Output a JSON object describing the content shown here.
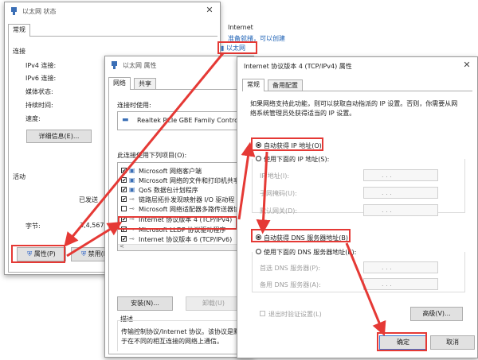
{
  "status_window": {
    "title": "以太网 状态",
    "tab": "常规",
    "section_connection": "连接",
    "ipv4_label": "IPv4 连接:",
    "ipv6_label": "IPv6 连接:",
    "media_label": "媒体状态:",
    "duration_label": "持续时间:",
    "speed_label": "速度:",
    "details_button": "详细信息(E)...",
    "section_activity": "活动",
    "sent_label": "已发送",
    "bytes_label": "字节:",
    "bytes_value": "3,4,567,3",
    "properties_button": "属性(P)",
    "disable_button": "禁用(D"
  },
  "network_list": {
    "heading": "Internet",
    "link": "准备就绪，可以创建",
    "ethernet": "以太网"
  },
  "props_window": {
    "title": "以太网 属性",
    "tabs": [
      "网络",
      "共享"
    ],
    "connect_using": "连接时使用:",
    "adapter": "Realtek PCIe GBE Family Controlle",
    "items_label": "此连接使用下列项目(O):",
    "items": [
      {
        "checked": "✔",
        "label": "Microsoft 网络客户端"
      },
      {
        "checked": "✔",
        "label": "Microsoft 网络的文件和打印机共享"
      },
      {
        "checked": "✔",
        "label": "QoS 数据包计划程序"
      },
      {
        "checked": "✔",
        "label": "链路层拓扑发现映射器 I/O 驱动程"
      },
      {
        "checked": "",
        "label": "Microsoft 网络适配器多路传送器协"
      },
      {
        "checked": "✔",
        "label": "Internet 协议版本 4 (TCP/IPv4)"
      },
      {
        "checked": "✔",
        "label": "Microsoft LLDP 协议驱动程序"
      },
      {
        "checked": "✔",
        "label": "Internet 协议版本 6 (TCP/IPv6)"
      }
    ],
    "install_button": "安装(N)...",
    "uninstall_button": "卸载(U)",
    "description_heading": "描述",
    "description_line1": "传输控制协议/Internet 协议。该协议是默",
    "description_line2": "于在不同的相互连接的网络上通信。"
  },
  "ipv4_window": {
    "title": "Internet 协议版本 4 (TCP/IPv4) 属性",
    "tabs": [
      "常规",
      "备用配置"
    ],
    "intro_line1": "如果网络支持此功能，则可以获取自动指派的 IP 设置。否则，你需要从网",
    "intro_line2": "络系统管理员处获得适当的 IP 设置。",
    "auto_ip": "自动获得 IP 地址(O)",
    "manual_ip": "使用下面的 IP 地址(S):",
    "ip_address": "IP 地址(I):",
    "subnet_mask": "子网掩码(U):",
    "gateway": "默认网关(D):",
    "auto_dns": "自动获得 DNS 服务器地址(B)",
    "manual_dns": "使用下面的 DNS 服务器地址(E):",
    "preferred_dns": "首选 DNS 服务器(P):",
    "alternate_dns": "备用 DNS 服务器(A):",
    "validate": "退出时验证设置(L)",
    "advanced_button": "高级(V)...",
    "ok_button": "确定",
    "cancel_button": "取消",
    "ip_dots": ". . ."
  },
  "annotation_color": "#e53935"
}
